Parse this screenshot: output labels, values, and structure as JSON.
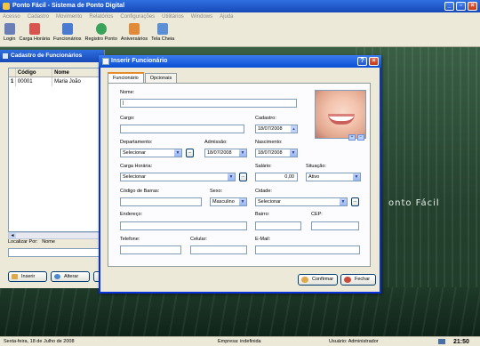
{
  "app": {
    "title": "Ponto Fácil - Sistema de Ponto Digital"
  },
  "menu": [
    "Acesso",
    "Cadastro",
    "Movimento",
    "Relatórios",
    "Configurações",
    "Utilitários",
    "Windows",
    "Ajuda"
  ],
  "toolbar": [
    {
      "label": "Login",
      "icon": "login-icon",
      "color": "#6a7fb8"
    },
    {
      "label": "Carga Horária",
      "icon": "calendar-icon",
      "color": "#d9534f"
    },
    {
      "label": "Funcionários",
      "icon": "users-icon",
      "color": "#4a7bd0"
    },
    {
      "label": "Registro Ponto",
      "icon": "clock-icon",
      "color": "#3aa35b"
    },
    {
      "label": "Aniversários",
      "icon": "cake-icon",
      "color": "#e08a3a"
    },
    {
      "label": "Tela Cheia",
      "icon": "monitor-icon",
      "color": "#5b8fd6"
    }
  ],
  "background": {
    "brand": "onto Fácil"
  },
  "cadastro": {
    "title": "Cadastro de Funcionários",
    "columns": [
      "Código",
      "Nome"
    ],
    "rows": [
      {
        "marker": "1",
        "codigo": "00001",
        "nome": "Maria João"
      }
    ],
    "localizar_label": "Localizar Por:",
    "localizar_by": "Nome",
    "buttons": {
      "inserir": "Inserir",
      "alterar": "Alterar"
    }
  },
  "dialog": {
    "title": "Inserir Funcionário",
    "tabs": [
      "Funcionário",
      "Opcionais"
    ],
    "fields": {
      "nome_label": "Nome:",
      "nome_value": "|",
      "cargo_label": "Cargo:",
      "cargo_value": "",
      "cadastro_label": "Cadastro:",
      "cadastro_value": "18/07/2008",
      "departamento_label": "Departamento:",
      "departamento_value": "Selecionar",
      "admissao_label": "Admissão:",
      "admissao_value": "18/07/2008",
      "nascimento_label": "Nascimento:",
      "nascimento_value": "18/07/2008",
      "carga_label": "Carga Horária:",
      "carga_value": "Selecionar",
      "salario_label": "Salário:",
      "salario_value": "0,00",
      "situacao_label": "Situação:",
      "situacao_value": "Ativo",
      "barras_label": "Código de Barras:",
      "barras_value": "",
      "sexo_label": "Sexo:",
      "sexo_value": "Masculino",
      "cidade_label": "Cidade:",
      "cidade_value": "Selecionar",
      "endereco_label": "Endereço:",
      "bairro_label": "Bairro:",
      "cep_label": "CEP:",
      "telefone_label": "Telefone:",
      "celular_label": "Celular:",
      "email_label": "E-Mail:"
    },
    "buttons": {
      "confirmar": "Confirmar",
      "fechar": "Fechar"
    }
  },
  "status": {
    "date": "Sexta-feira, 18 de Julho de 2008",
    "empresa": "Empresa: indefinida",
    "usuario": "Usuário: Administrador",
    "clock": "21:50"
  }
}
